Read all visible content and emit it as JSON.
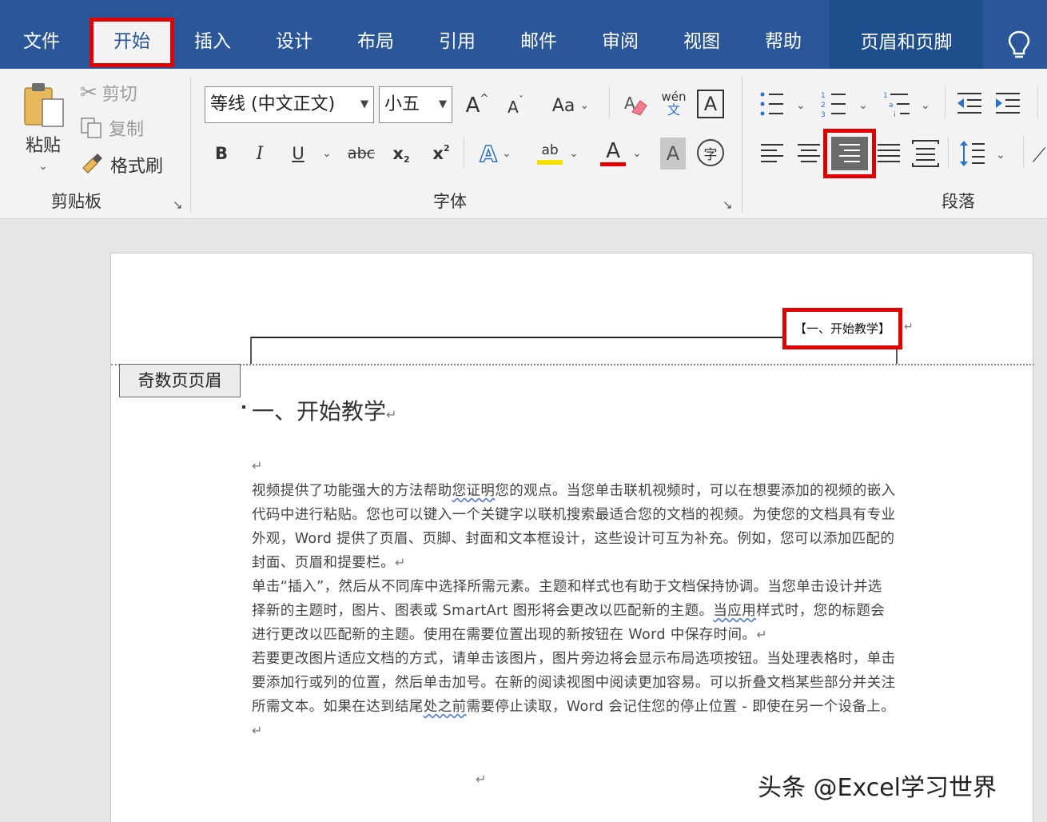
{
  "tabs": {
    "file": "文件",
    "home": "开始",
    "insert": "插入",
    "design": "设计",
    "layout": "布局",
    "references": "引用",
    "mailings": "邮件",
    "review": "审阅",
    "view": "视图",
    "help": "帮助",
    "header_footer": "页眉和页脚"
  },
  "clipboard": {
    "paste": "粘贴",
    "cut": "剪切",
    "copy": "复制",
    "format_painter": "格式刷",
    "label": "剪贴板"
  },
  "font": {
    "name": "等线 (中文正文)",
    "size": "小五",
    "grow": "A",
    "shrink": "A",
    "case": "Aa",
    "phonetic_top": "wén",
    "phonetic_bottom": "文",
    "border_char": "A",
    "bold": "B",
    "italic": "I",
    "underline": "U",
    "strike": "abc",
    "subscript": "x",
    "subscript_mark": "2",
    "superscript": "x",
    "superscript_mark": "2",
    "effects": "A",
    "highlight": "ab",
    "color": "A",
    "shading": "A",
    "enclose": "字",
    "label": "字体"
  },
  "paragraph": {
    "label": "段落"
  },
  "document": {
    "header_text": "【一、开始教学】",
    "header_tag": "奇数页页眉",
    "heading": "一、开始教学",
    "para1_a": "视频提供了功能强大的方法帮助",
    "para1_sq": "您证明",
    "para1_b": "您的观点。当您单击联机视频时，可以在想要添加的视频的嵌入代码中进行粘贴。您也可以键入一个关键字以联机搜索最适合您的文档的视频。为使您的文档具有专业外观，Word 提供了页眉、页脚、封面和文本框设计，这些设计可互为补充。例如，您可以添加匹配的封面、页眉和提要栏。",
    "para2_a": "单击“插入”，然后从不同库中选择所需元素。主题和样式也有助于文档保持协调。当您单击设计并选择新的主题时，图片、图表或 SmartArt 图形将会更改以匹配新的主题。",
    "para2_sq": "当应用",
    "para2_b": "样式时，您的标题会进行更改以匹配新的主题。使用在需要位置出现的新按钮在 Word 中保存时间。",
    "para3_a": "若要更改图片适应文档的方式，请单击该图片，图片旁边将会显示布局选项按钮。当处理表格时，单击要添加行或列的位置，然后单击加号。在新的阅读视图中阅读更加容易。可以折叠文档某些部分并关注所需文本。如果在达到结尾",
    "para3_sq": "处之前",
    "para3_b": "需要停止读取，Word 会记住您的停止位置 - 即使在另一个设备上。",
    "para_mark": "↵"
  },
  "watermark": "头条 @Excel学习世界",
  "colors": {
    "tab_bar": "#2b579a",
    "highlight_box": "#e00000",
    "ribbon_bg": "#f3f3f3"
  }
}
